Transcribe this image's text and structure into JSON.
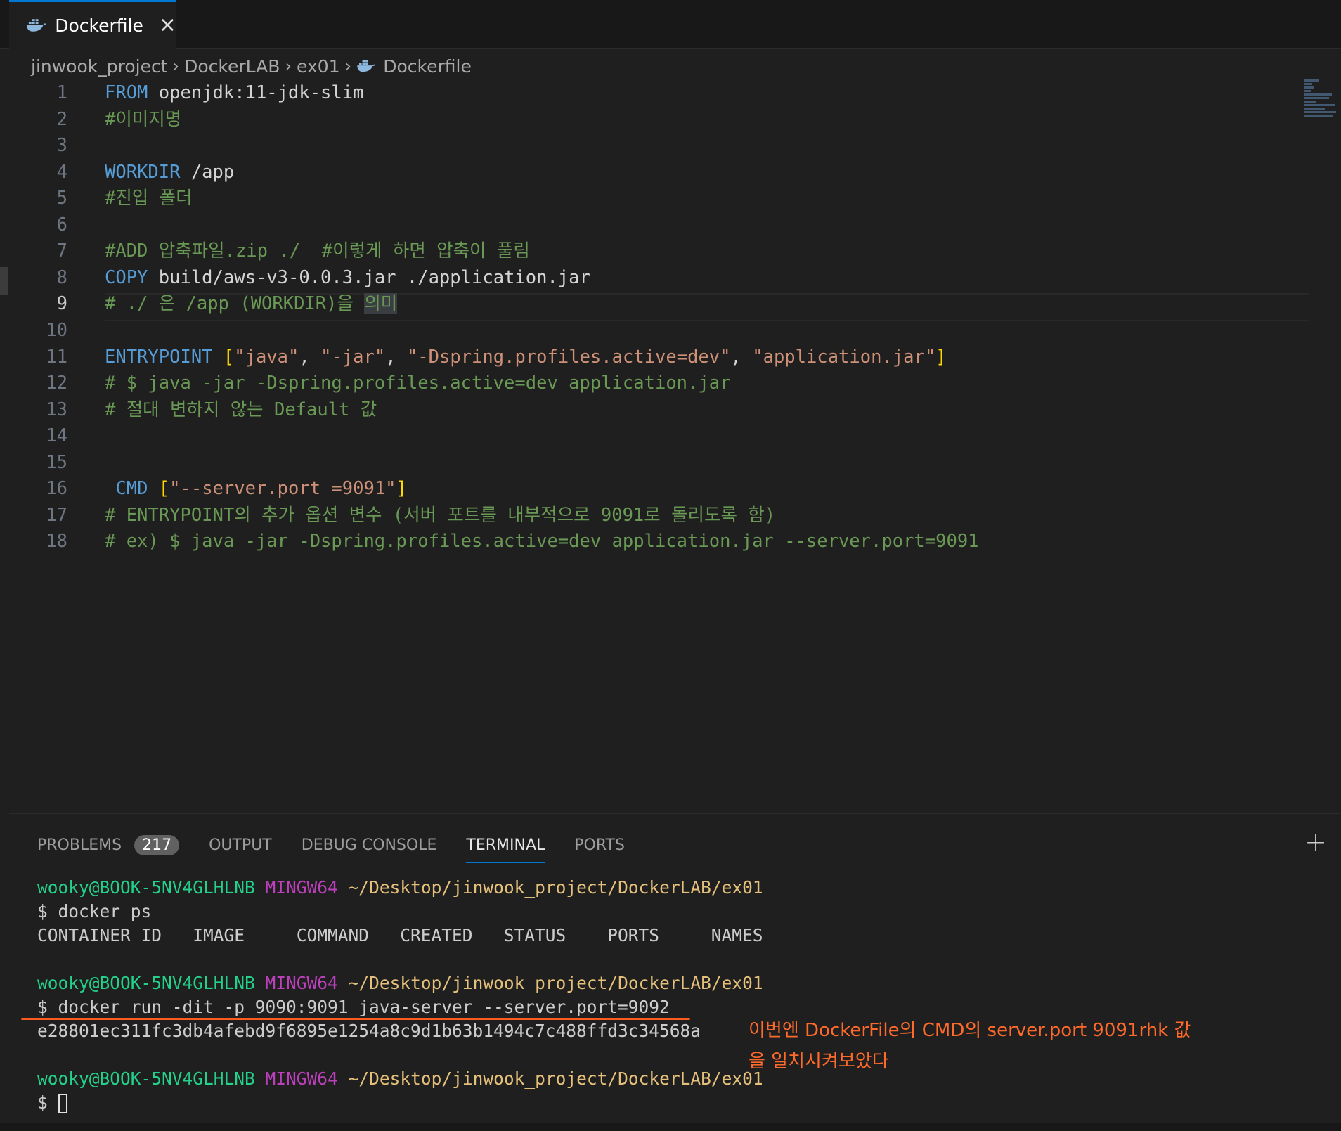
{
  "tab": {
    "title": "Dockerfile"
  },
  "breadcrumb": [
    "jinwook_project",
    "DockerLAB",
    "ex01",
    "Dockerfile"
  ],
  "editor": {
    "lines": [
      {
        "n": "1",
        "parts": [
          [
            "kw",
            "FROM"
          ],
          [
            "plain",
            " openjdk:11-jdk-slim"
          ]
        ]
      },
      {
        "n": "2",
        "parts": [
          [
            "cm",
            "#이미지명"
          ]
        ]
      },
      {
        "n": "3",
        "parts": []
      },
      {
        "n": "4",
        "parts": [
          [
            "kw",
            "WORKDIR"
          ],
          [
            "plain",
            " /app"
          ]
        ]
      },
      {
        "n": "5",
        "parts": [
          [
            "cm",
            "#진입 폴더"
          ]
        ]
      },
      {
        "n": "6",
        "parts": []
      },
      {
        "n": "7",
        "parts": [
          [
            "cm",
            "#ADD 압축파일.zip ./  #이렇게 하면 압축이 풀림"
          ]
        ]
      },
      {
        "n": "8",
        "parts": [
          [
            "kw",
            "COPY"
          ],
          [
            "plain",
            " build/aws-v3-0.0.3.jar ./application.jar"
          ]
        ]
      },
      {
        "n": "9",
        "parts": [
          [
            "cm",
            "# ./ 은 /app (WORKDIR)을 "
          ],
          [
            "cm sel",
            "의미"
          ]
        ]
      },
      {
        "n": "10",
        "parts": []
      },
      {
        "n": "11",
        "parts": [
          [
            "kw",
            "ENTRYPOINT"
          ],
          [
            "plain",
            " "
          ],
          [
            "br",
            "["
          ],
          [
            "str",
            "\"java\""
          ],
          [
            "plain",
            ", "
          ],
          [
            "str",
            "\"-jar\""
          ],
          [
            "plain",
            ", "
          ],
          [
            "str",
            "\"-Dspring.profiles.active=dev\""
          ],
          [
            "plain",
            ", "
          ],
          [
            "str",
            "\"application.jar\""
          ],
          [
            "br",
            "]"
          ]
        ]
      },
      {
        "n": "12",
        "parts": [
          [
            "cm",
            "# $ java -jar -Dspring.profiles.active=dev application.jar"
          ]
        ]
      },
      {
        "n": "13",
        "parts": [
          [
            "cm",
            "# 절대 변하지 않는 Default 값"
          ]
        ]
      },
      {
        "n": "14",
        "parts": []
      },
      {
        "n": "15",
        "parts": []
      },
      {
        "n": "16",
        "parts": [
          [
            "plain",
            " "
          ],
          [
            "kw",
            "CMD"
          ],
          [
            "plain",
            " "
          ],
          [
            "br",
            "["
          ],
          [
            "str",
            "\"--server.port =9091\""
          ],
          [
            "br",
            "]"
          ]
        ]
      },
      {
        "n": "17",
        "parts": [
          [
            "cm",
            "# ENTRYPOINT의 추가 옵션 변수 (서버 포트를 내부적으로 9091로 돌리도록 함)"
          ]
        ]
      },
      {
        "n": "18",
        "parts": [
          [
            "cm",
            "# ex) $ java -jar -Dspring.profiles.active=dev application.jar --server.port=9091"
          ]
        ]
      }
    ],
    "active_line": "9"
  },
  "panel": {
    "tabs": [
      "PROBLEMS",
      "OUTPUT",
      "DEBUG CONSOLE",
      "TERMINAL",
      "PORTS"
    ],
    "problems_count": "217",
    "active_tab": "TERMINAL"
  },
  "terminal": {
    "prompt_user": "wooky@BOOK-5NV4GLHLNB",
    "prompt_env": "MINGW64",
    "prompt_path": "~/Desktop/jinwook_project/DockerLAB/ex01",
    "cmd1": "$ docker ps",
    "ps_header": "CONTAINER ID   IMAGE     COMMAND   CREATED   STATUS    PORTS     NAMES",
    "cmd2": "$ docker run -dit -p 9090:9091 java-server --server.port=9092",
    "container_id": "e28801ec311fc3db4afebd9f6895e1254a8c9d1b63b1494c7c488ffd3c34568a",
    "prompt_symbol": "$"
  },
  "annotation": {
    "line1": "이번엔 DockerFile의 CMD의 server.port 9091rhk 값",
    "line2": "을 일치시켜보았다"
  },
  "colors": {
    "accent": "#0078d4",
    "annotation": "#ff6a2a"
  }
}
